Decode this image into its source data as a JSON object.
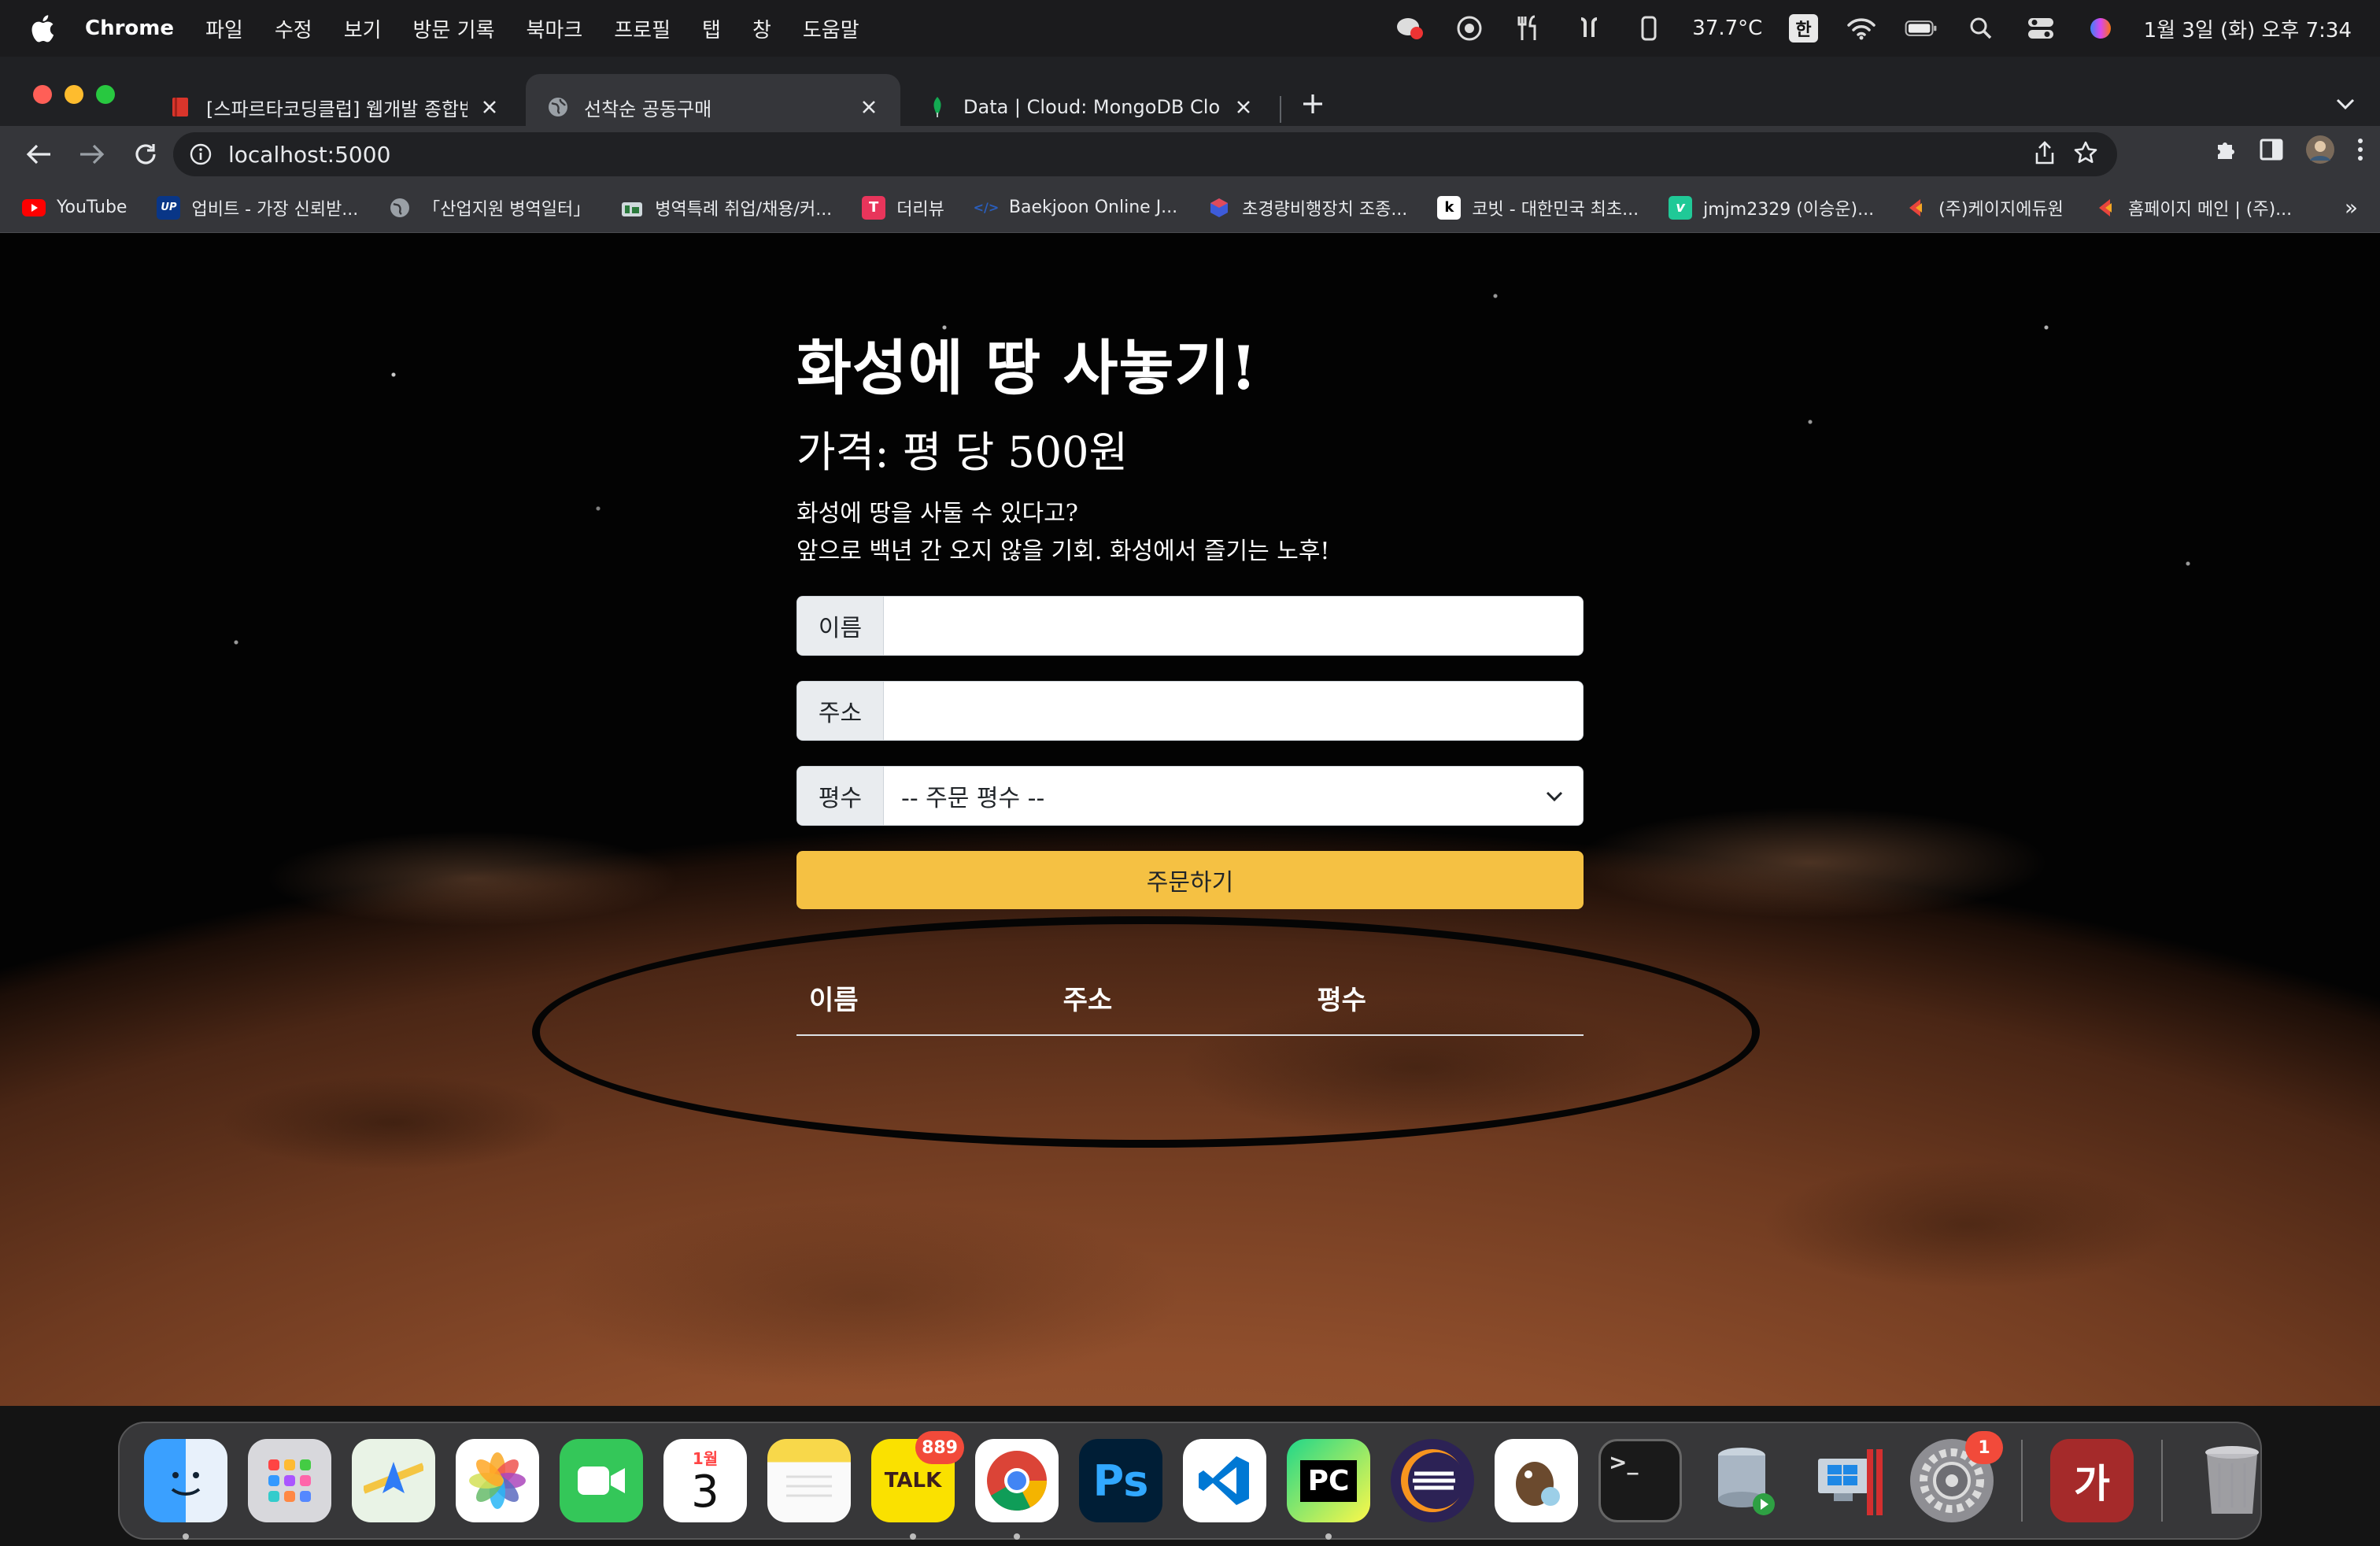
{
  "menubar": {
    "app_name": "Chrome",
    "items": [
      "파일",
      "수정",
      "보기",
      "방문 기록",
      "북마크",
      "프로필",
      "탭",
      "창",
      "도움말"
    ],
    "temperature": "37.7°C",
    "input_method": "한",
    "datetime": "1월 3일 (화) 오후 7:34"
  },
  "tabs": [
    {
      "title": "[스파르타코딩클럽] 웹개발 종합반 -",
      "active": false
    },
    {
      "title": "선착순 공동구매",
      "active": true
    },
    {
      "title": "Data | Cloud: MongoDB Cloud",
      "active": false
    }
  ],
  "toolbar": {
    "url": "localhost:5000"
  },
  "bookmarks": [
    {
      "label": "YouTube",
      "icon": "youtube-icon",
      "color": "#ff0000"
    },
    {
      "label": "업비트 - 가장 신뢰받...",
      "icon": "upbit-icon",
      "color": "#093687",
      "glyph": "UP"
    },
    {
      "label": "「산업지원 병역일터」",
      "icon": "globe-icon",
      "color": "#5f6368"
    },
    {
      "label": "병역특례 취업/채용/커...",
      "icon": "job-icon",
      "color": "#2b7a3d"
    },
    {
      "label": "더리뷰",
      "icon": "thereview-icon",
      "color": "#e8355b",
      "glyph": "T"
    },
    {
      "label": "Baekjoon Online J...",
      "icon": "code-icon",
      "color": "#2a5ebd",
      "glyph": "</>"
    },
    {
      "label": "초경량비행장치 조종...",
      "icon": "cube-icon",
      "color": "#3d5bd9"
    },
    {
      "label": "코빗 - 대한민국 최초...",
      "icon": "korbit-icon",
      "color": "#ffffff",
      "glyph": "k"
    },
    {
      "label": "jmjm2329 (이승운)...",
      "icon": "velog-icon",
      "color": "#20c997",
      "glyph": "v"
    },
    {
      "label": "(주)케이지에듀원",
      "icon": "kg-icon",
      "color": "#e8453c"
    },
    {
      "label": "홈페이지 메인 | (주)...",
      "icon": "kg-icon",
      "color": "#e8453c"
    }
  ],
  "page": {
    "title": "화성에 땅 사놓기!",
    "price": "가격: 평 당 500원",
    "desc_line1": "화성에 땅을 사둘 수 있다고?",
    "desc_line2": "앞으로 백년 간 오지 않을 기회. 화성에서 즐기는 노후!",
    "name_label": "이름",
    "name_value": "",
    "address_label": "주소",
    "address_value": "",
    "size_label": "평수",
    "size_selected": "-- 주문 평수 --",
    "order_button": "주문하기",
    "table_headers": [
      "이름",
      "주소",
      "평수"
    ],
    "accent_color": "#f5c143"
  },
  "dock": {
    "kakaotalk_badge": "889",
    "settings_badge": "1",
    "kakaotalk_label": "TALK",
    "pycharm_label": "PC",
    "photoshop_label": "Ps",
    "calendar_month": "1월",
    "calendar_day": "3",
    "dictionary_label": "가"
  }
}
